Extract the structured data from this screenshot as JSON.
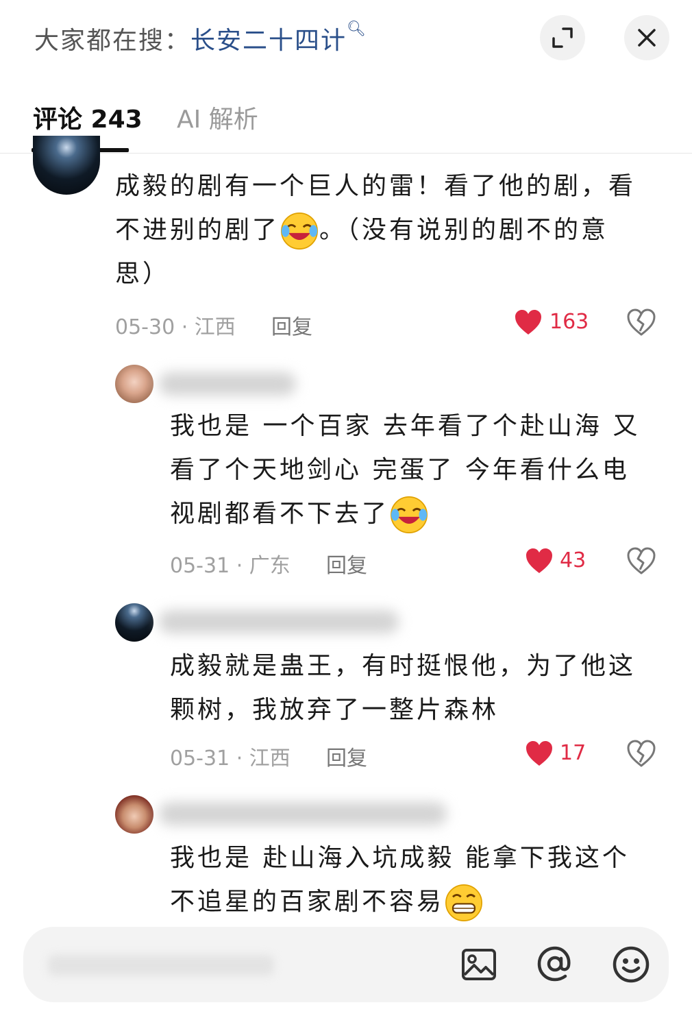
{
  "header": {
    "search_prefix": "大家都在搜：",
    "search_keyword": "长安二十四计"
  },
  "tabs": [
    {
      "label": "评论 243",
      "active": true
    },
    {
      "label": "AI 解析",
      "active": false
    }
  ],
  "comments": [
    {
      "text_line1": "成毅的剧有一个巨人的雷！看了他的剧，看",
      "text_line2a": "不进别的剧了",
      "text_line2b": "。（没有说别的剧不的意",
      "text_line3": "思）",
      "meta": "05-30 · 江西",
      "reply": "回复",
      "likes": "163"
    },
    {
      "text_line1": "我也是 一个百家 去年看了个赴山海 又",
      "text_line2": "看了个天地剑心 完蛋了 今年看什么电",
      "text_line3": "视剧都看不下去了",
      "meta": "05-31 · 广东",
      "reply": "回复",
      "likes": "43"
    },
    {
      "text_line1": "成毅就是蛊王，有时挺恨他，为了他这",
      "text_line2": "颗树，我放弃了一整片森林",
      "meta": "05-31 · 江西",
      "reply": "回复",
      "likes": "17"
    },
    {
      "text_line1": "我也是 赴山海入坑成毅 能拿下我这个",
      "text_line2": "不追星的百家剧不容易"
    }
  ],
  "colors": {
    "like_red": "#e02b45",
    "keyword_blue": "#2a4f8a"
  },
  "icons": [
    "search-icon",
    "expand-icon",
    "close-icon",
    "heart-icon",
    "broken-heart-icon",
    "image-icon",
    "at-icon",
    "emoji-icon"
  ]
}
